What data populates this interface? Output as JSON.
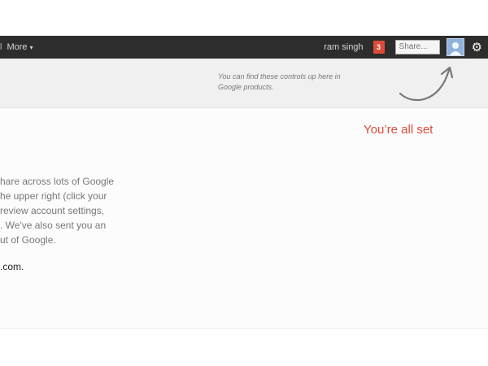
{
  "topbar": {
    "separator": "l",
    "more_label": "More",
    "more_caret": "▾",
    "username": "ram singh",
    "notification_count": "3",
    "share_placeholder": "Share...",
    "gear_glyph": "⚙"
  },
  "infobar": {
    "lines": [
      "You can find these controls up here in",
      "Google products."
    ]
  },
  "main": {
    "status_title": "You’re all set",
    "body_lines": [
      "hare across lots of Google",
      "he upper right (click your",
      "review account settings,",
      ". We've also sent you an",
      "ut of Google."
    ],
    "email_fragment": ".com",
    "email_suffix": "."
  },
  "colors": {
    "topbar_bg": "#2d2d2d",
    "notif_red": "#dd4b39",
    "title_red": "#dd4b39",
    "infobar_bg": "#f0f0f0"
  }
}
